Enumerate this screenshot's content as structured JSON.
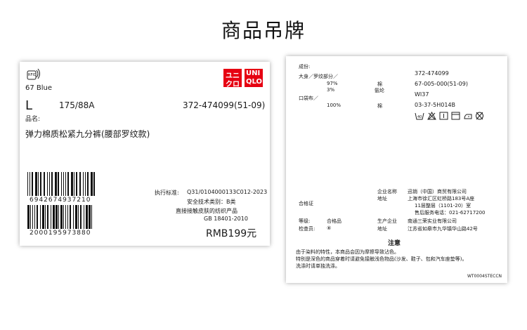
{
  "page": {
    "title": "商品吊牌"
  },
  "left_tag": {
    "rfid_label": "RFID",
    "logo_left": [
      "ユニ",
      "クロ"
    ],
    "logo_right": [
      "UNI",
      "QLO"
    ],
    "color": "67  Blue",
    "size": "L",
    "height_spec": "175/88A",
    "product_code": "372-474099(51-09)",
    "name_label": "品名:",
    "product_name": "弹力棉质松紧九分裤(腰部罗纹款)",
    "barcode1_number": "6942674937210",
    "barcode2_number": "2000195973880",
    "standard_label": "执行标准:",
    "standard_value": "Q31/0104000133C012-2023",
    "safety_category": "安全技术类别：B类",
    "skin_contact": "直接接触皮肤的纺织产品",
    "gb_standard": "GB 18401-2010",
    "price": "RMB199元"
  },
  "right_tag": {
    "composition_label": "成份:",
    "body_label": "大身／罗纹部分／",
    "body_pct1": "97%",
    "body_pct2": "3%",
    "body_fiber1": "棉",
    "body_fiber2": "氨纶",
    "pocket_label": "口袋布／",
    "pocket_pct": "100%",
    "pocket_fiber": "棉",
    "code1": "372-474099",
    "code2": "67-005-000(51-09)",
    "code3": "WI37",
    "code4": "03-37-5H014B",
    "care_icons": [
      "wash-40-icon",
      "no-bleach-icon",
      "tumble-dry-icon",
      "iron-low-icon",
      "dry-clean-icon",
      "no-wring-icon"
    ],
    "wash_temp": "40",
    "certificate_label": "合格证",
    "company_label": "企业名称",
    "company_name": "迅销（中国）商贸有限公司",
    "address_label": "地址",
    "address_line1": "上海市徐汇区虹桥路183号A座",
    "address_line2": "11层整层（1101-20）室",
    "service_phone": "售后服务电话：021-62717200",
    "grade_label": "等级:",
    "grade_value": "合格品",
    "inspector_label": "检查员:",
    "inspector_value": "⑧",
    "producer_label": "生产企业",
    "producer_name": "南通三荣实业有限公司",
    "producer_address_label": "地址",
    "producer_address": "江苏省如皋市九华镇华山路42号",
    "notice_title": "注意",
    "notice_line1": "由于染料的特性，本商品会因为摩擦导致沾色。",
    "notice_line2": "特别是深色的商品穿着时请避免接触浅色物品(沙发、鞋子、包和汽车座垫等)。",
    "notice_line3": "洗涤时请单独洗涤。",
    "footer_code": "WT0004STECCN"
  },
  "colors": {
    "logo_red": "#e60012",
    "text": "#1a1a1a"
  }
}
